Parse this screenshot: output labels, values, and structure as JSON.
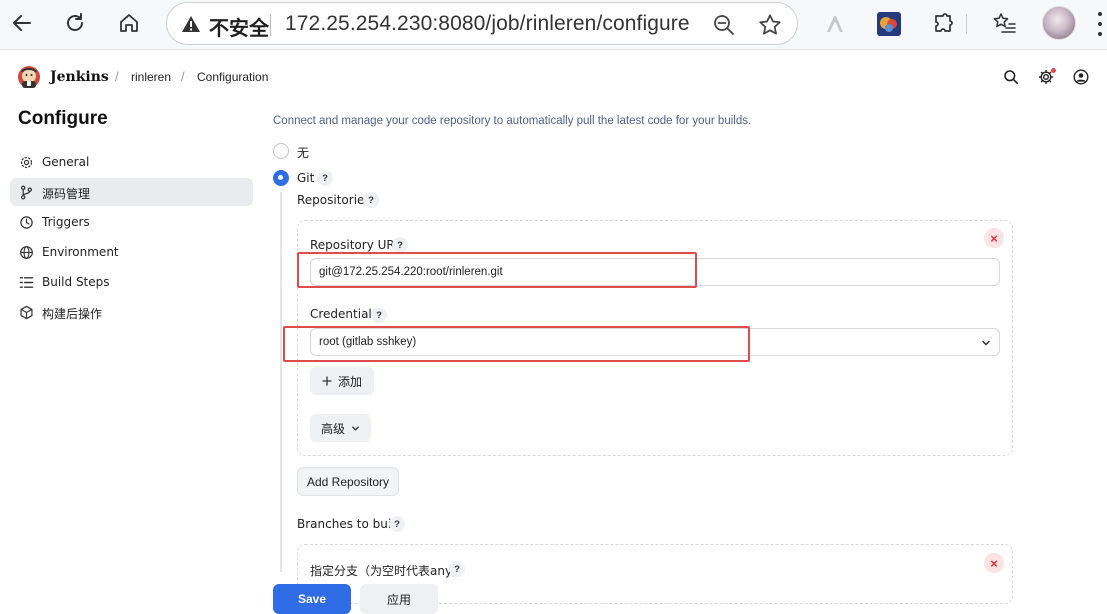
{
  "browser": {
    "insecure_label": "不安全",
    "url": "172.25.254.230:8080/job/rinleren/configure"
  },
  "header": {
    "brand": "Jenkins",
    "breadcrumbs": [
      "rinleren",
      "Configuration"
    ]
  },
  "sidebar": {
    "title": "Configure",
    "items": [
      {
        "label": "General",
        "icon": "gear-icon"
      },
      {
        "label": "源码管理",
        "icon": "branch-icon"
      },
      {
        "label": "Triggers",
        "icon": "clock-icon"
      },
      {
        "label": "Environment",
        "icon": "globe-icon"
      },
      {
        "label": "Build Steps",
        "icon": "list-icon"
      },
      {
        "label": "构建后操作",
        "icon": "cube-icon"
      }
    ],
    "active_index": 1
  },
  "scm": {
    "intro": "Connect and manage your code repository to automatically pull the latest code for your builds.",
    "options": [
      {
        "label": "无",
        "selected": false
      },
      {
        "label": "Git",
        "selected": true
      }
    ],
    "help_glyph": "?",
    "repositories_label": "Repositories",
    "repository_url_label": "Repository URL",
    "repository_url_value": "git@172.25.254.220:root/rinleren.git",
    "credentials_label": "Credentials",
    "credentials_value": "root (gitlab sshkey)",
    "add_label": "添加",
    "advanced_label": "高级",
    "add_repository_label": "Add Repository",
    "branches_label": "Branches to build",
    "branch_specifier_label": "指定分支（为空时代表any）"
  },
  "footer": {
    "save_label": "Save",
    "apply_label": "应用"
  },
  "colors": {
    "primary": "#2f6ce5",
    "highlight_box": "#e14b4b",
    "remove_button": "#d33"
  }
}
